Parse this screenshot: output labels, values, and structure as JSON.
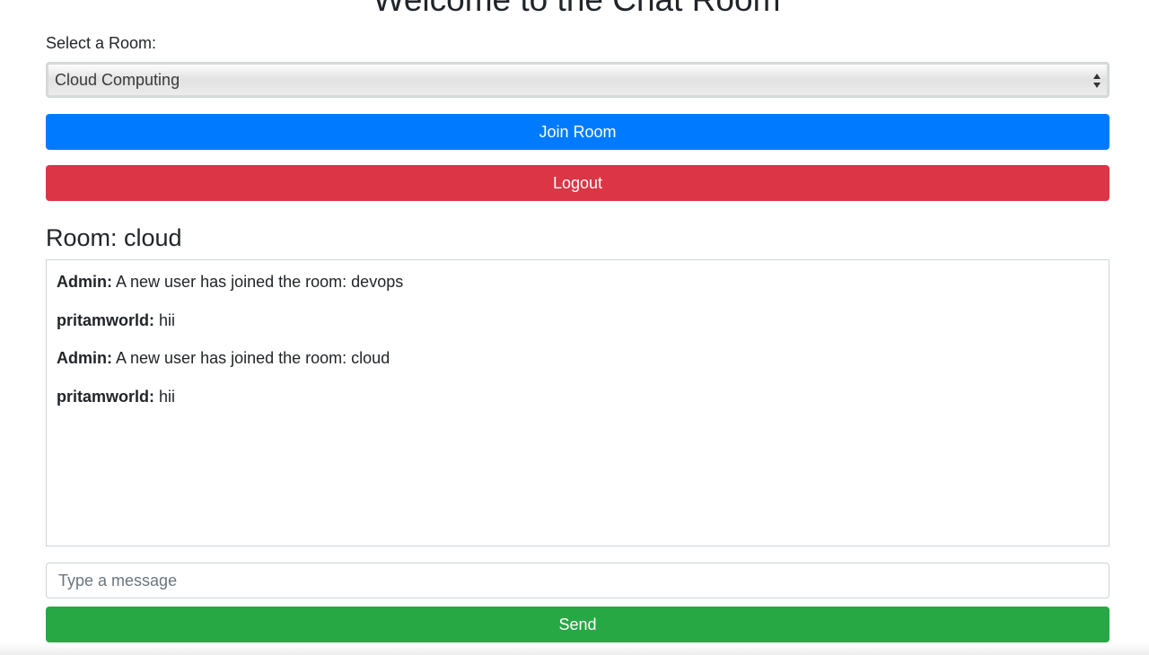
{
  "header": {
    "title": "Welcome to the Chat Room"
  },
  "room_select": {
    "label": "Select a Room:",
    "selected": "Cloud Computing"
  },
  "actions": {
    "join_label": "Join Room",
    "logout_label": "Logout"
  },
  "room": {
    "heading": "Room: cloud"
  },
  "messages": [
    {
      "sender": "Admin:",
      "text": "A new user has joined the room: devops"
    },
    {
      "sender": "pritamworld:",
      "text": "hii"
    },
    {
      "sender": "Admin:",
      "text": "A new user has joined the room: cloud"
    },
    {
      "sender": "pritamworld:",
      "text": "hii"
    }
  ],
  "composer": {
    "placeholder": "Type a message",
    "send_label": "Send"
  },
  "colors": {
    "join": "#007bff",
    "logout": "#dc3545",
    "send": "#28a745"
  }
}
